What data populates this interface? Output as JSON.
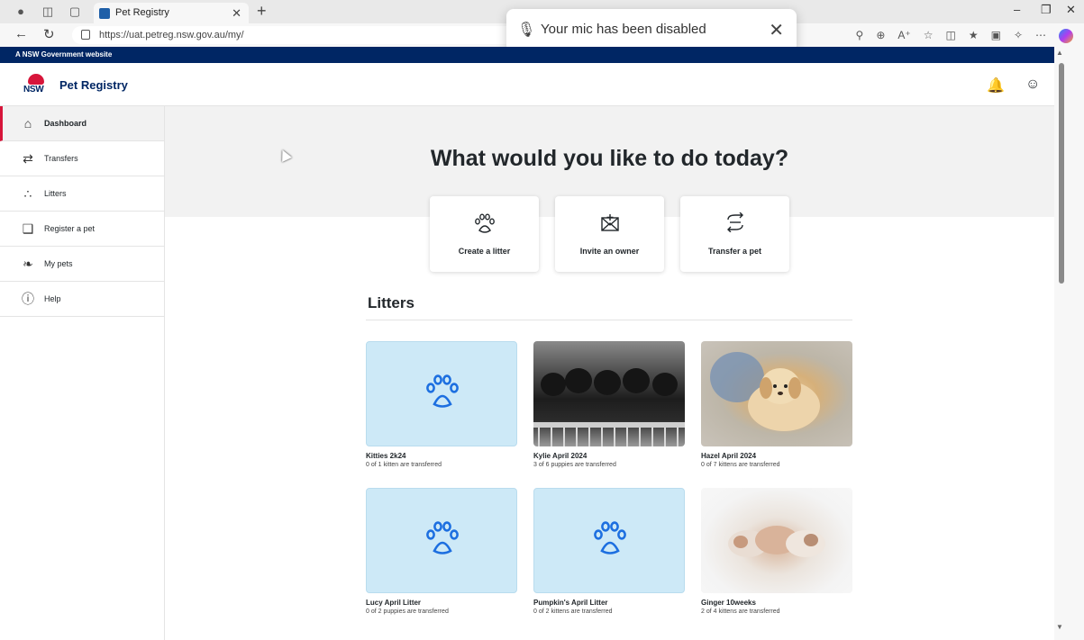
{
  "browser": {
    "tab_title": "Pet Registry",
    "url": "https://uat.petreg.nsw.gov.au/my/",
    "toast_message": "Your mic has been disabled"
  },
  "gov_banner": "A NSW Government website",
  "header": {
    "logo_text": "NSW",
    "site_name": "Pet Registry",
    "icons": [
      "notification-icon",
      "account-icon"
    ]
  },
  "sidebar": {
    "items": [
      {
        "label": "Dashboard",
        "icon": "home-icon",
        "active": true
      },
      {
        "label": "Transfers",
        "icon": "transfer-icon",
        "active": false
      },
      {
        "label": "Litters",
        "icon": "paw-icon",
        "active": false
      },
      {
        "label": "Register a pet",
        "icon": "register-pet-icon",
        "active": false
      },
      {
        "label": "My pets",
        "icon": "pets-icon",
        "active": false
      },
      {
        "label": "Help",
        "icon": "help-icon",
        "active": false
      }
    ]
  },
  "main": {
    "headline": "What would you like to do today?",
    "actions": [
      {
        "label": "Create a litter",
        "icon": "paw-icon"
      },
      {
        "label": "Invite an owner",
        "icon": "invite-icon"
      },
      {
        "label": "Transfer a pet",
        "icon": "transfer-icon"
      }
    ],
    "section_title": "Litters",
    "litters": [
      {
        "name": "Kitties 2k24",
        "status": "0 of 1 kitten are transferred",
        "image": "placeholder-paw"
      },
      {
        "name": "Kylie April 2024",
        "status": "3 of 6 puppies are transferred",
        "image": "black-puppies-photo"
      },
      {
        "name": "Hazel April 2024",
        "status": "0 of 7 kittens are transferred",
        "image": "golden-puppy-photo"
      },
      {
        "name": "Lucy April Litter",
        "status": "0 of 2 puppies are transferred",
        "image": "placeholder-paw"
      },
      {
        "name": "Pumpkin's April Litter",
        "status": "0 of 2 kittens are transferred",
        "image": "placeholder-paw"
      },
      {
        "name": "Ginger 10weeks",
        "status": "2 of 4 kittens are transferred",
        "image": "newborn-kittens-photo"
      }
    ]
  },
  "colors": {
    "gov_navy": "#002664",
    "nsw_red": "#d7153a",
    "placeholder_blue": "#cde9f7",
    "paw_blue": "#1d6fe0"
  }
}
